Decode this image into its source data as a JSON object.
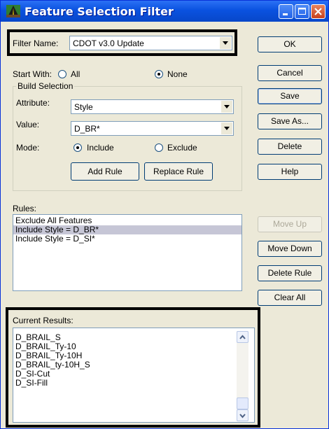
{
  "window": {
    "title": "Feature Selection Filter"
  },
  "filter": {
    "label": "Filter Name:",
    "value": "CDOT v3.0 Update"
  },
  "start_with": {
    "label": "Start With:",
    "option_all": "All",
    "option_none": "None",
    "selected": "None"
  },
  "build": {
    "title": "Build Selection",
    "attribute_label": "Attribute:",
    "attribute_value": "Style",
    "value_label": "Value:",
    "value_value": "D_BR*",
    "mode_label": "Mode:",
    "mode_include": "Include",
    "mode_exclude": "Exclude",
    "mode_selected": "Include",
    "add_rule": "Add Rule",
    "replace_rule": "Replace Rule"
  },
  "rules": {
    "label": "Rules:",
    "items": [
      "Exclude All Features",
      "Include Style = D_BR*",
      "Include Style = D_SI*"
    ],
    "selected_index": 1
  },
  "results": {
    "label": "Current Results:",
    "items": [
      "D_BRAIL_S",
      "D_BRAIL_Ty-10",
      "D_BRAIL_Ty-10H",
      "D_BRAIL_ty-10H_S",
      "D_SI-Cut",
      "D_SI-Fill"
    ]
  },
  "buttons": {
    "ok": "OK",
    "cancel": "Cancel",
    "save": "Save",
    "save_as": "Save As...",
    "delete": "Delete",
    "help": "Help",
    "move_up": "Move Up",
    "move_down": "Move Down",
    "delete_rule": "Delete Rule",
    "clear_all": "Clear All"
  }
}
